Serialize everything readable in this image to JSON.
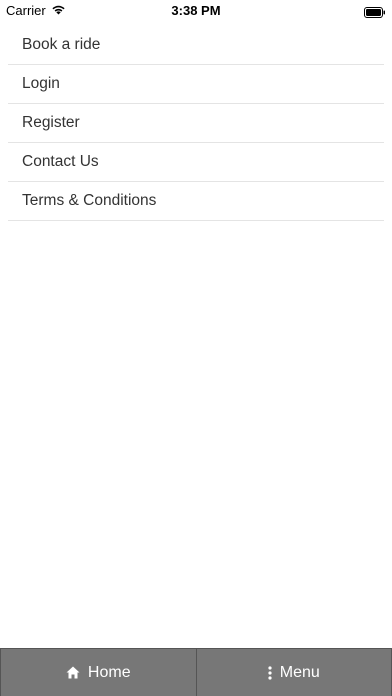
{
  "status_bar": {
    "carrier": "Carrier",
    "time": "3:38 PM"
  },
  "menu": {
    "items": [
      {
        "label": "Book a ride"
      },
      {
        "label": "Login"
      },
      {
        "label": "Register"
      },
      {
        "label": "Contact Us"
      },
      {
        "label": "Terms & Conditions"
      }
    ]
  },
  "bottom_nav": {
    "home_label": "Home",
    "home_icon": "home-icon",
    "menu_label": "Menu",
    "menu_icon": "vertical-dots-icon"
  },
  "colors": {
    "bottom_bar_bg": "#777777",
    "text": "#333333",
    "divider": "#e4e4e4"
  }
}
